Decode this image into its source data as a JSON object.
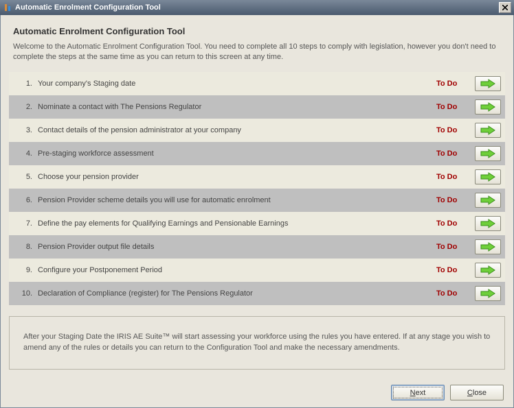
{
  "window": {
    "title": "Automatic Enrolment Configuration Tool"
  },
  "heading": "Automatic Enrolment Configuration Tool",
  "intro": "Welcome to the Automatic Enrolment Configuration Tool.  You need to complete all 10 steps to comply with legislation, however you don't need to complete the steps at the same time as you can return to this screen at any time.",
  "steps": [
    {
      "num": "1.",
      "label": "Your company's Staging date",
      "status": "To Do"
    },
    {
      "num": "2.",
      "label": "Nominate a contact with The Pensions Regulator",
      "status": "To Do"
    },
    {
      "num": "3.",
      "label": "Contact details of the pension administrator at your company",
      "status": "To Do"
    },
    {
      "num": "4.",
      "label": "Pre-staging workforce assessment",
      "status": "To Do"
    },
    {
      "num": "5.",
      "label": "Choose your pension provider",
      "status": "To Do"
    },
    {
      "num": "6.",
      "label": "Pension Provider scheme details you will use for automatic enrolment",
      "status": "To Do"
    },
    {
      "num": "7.",
      "label": "Define the pay elements for Qualifying Earnings and Pensionable Earnings",
      "status": "To Do"
    },
    {
      "num": "8.",
      "label": "Pension Provider output file details",
      "status": "To Do"
    },
    {
      "num": "9.",
      "label": "Configure your Postponement Period",
      "status": "To Do"
    },
    {
      "num": "10.",
      "label": "Declaration of Compliance (register) for The Pensions Regulator",
      "status": "To Do"
    }
  ],
  "info_panel": "After your Staging Date the IRIS AE Suite™ will start assessing your workforce using the rules you have entered.  If at any stage you wish to amend any of the rules or details you can return to the Configuration Tool and make the necessary amendments.",
  "buttons": {
    "next": "Next",
    "close": "Close"
  },
  "colors": {
    "status": "#a00000",
    "row_even": "#bfbfbf",
    "row_odd": "#eceade",
    "arrow_fill": "#6fcf3a",
    "arrow_stroke": "#3a8f1a"
  }
}
